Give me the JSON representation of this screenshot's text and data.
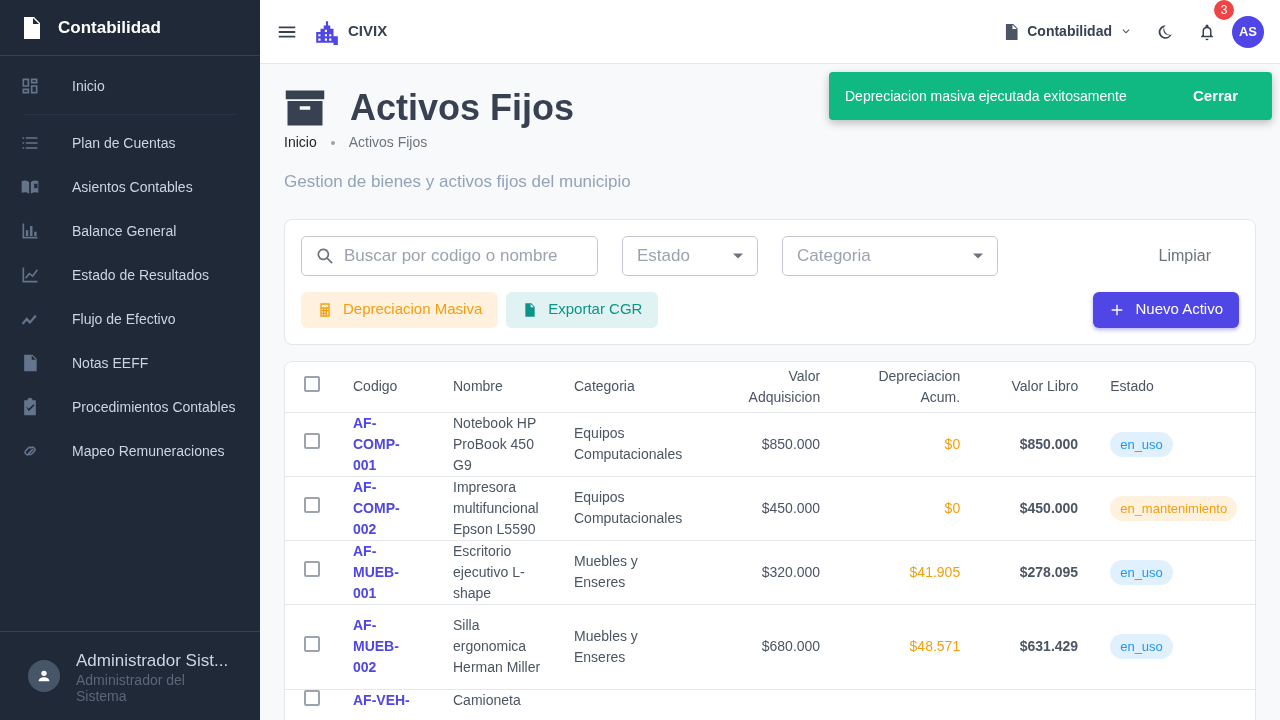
{
  "sidebar": {
    "title": "Contabilidad",
    "items": [
      {
        "label": "Inicio",
        "selected": false
      },
      {
        "label": "Plan de Cuentas",
        "selected": false
      },
      {
        "label": "Asientos Contables",
        "selected": false
      },
      {
        "label": "Balance General",
        "selected": false
      },
      {
        "label": "Estado de Resultados",
        "selected": false
      },
      {
        "label": "Flujo de Efectivo",
        "selected": false
      },
      {
        "label": "Notas EEFF",
        "selected": false
      },
      {
        "label": "Procedimientos Contables",
        "selected": false
      },
      {
        "label": "Mapeo Remuneraciones",
        "selected": false
      }
    ],
    "user": {
      "name": "Administrador Sist...",
      "role": "Administrador del Sistema"
    }
  },
  "topbar": {
    "brand": "CIVIX",
    "module": "Contabilidad",
    "notifications": "3",
    "avatar": "AS"
  },
  "toast": {
    "message": "Depreciacion masiva ejecutada exitosamente",
    "action": "Cerrar"
  },
  "page": {
    "title": "Activos Fijos",
    "breadcrumb": [
      "Inicio",
      "Activos Fijos"
    ],
    "subtitle": "Gestion de bienes y activos fijos del municipio"
  },
  "filters": {
    "search": {
      "placeholder": "Buscar por codigo o nombre"
    },
    "estado": {
      "placeholder": "Estado"
    },
    "categoria": {
      "placeholder": "Categoria"
    },
    "clear": "Limpiar"
  },
  "actions": [
    {
      "label": "Depreciacion Masiva",
      "kind": "warning"
    },
    {
      "label": "Exportar CGR",
      "kind": "teal"
    },
    {
      "label": "Nuevo Activo",
      "kind": "primary"
    }
  ],
  "table": {
    "select_all_checked": false,
    "columns": [
      "Codigo",
      "Nombre",
      "Categoria",
      "Valor Adquisicion",
      "Depreciacion Acum.",
      "Valor Libro",
      "Estado"
    ],
    "rows": [
      {
        "checked": false,
        "code": "AF-COMP-001",
        "name": "Notebook HP ProBook 450 G9",
        "category": "Equipos Computacionales",
        "value": "$850.000",
        "depreciation": "$0",
        "book": "$850.000",
        "status": "en_uso",
        "color": "#2196f3"
      },
      {
        "checked": false,
        "code": "AF-COMP-002",
        "name": "Impresora multifuncional Epson L5590",
        "category": "Equipos Computacionales",
        "value": "$450.000",
        "depreciation": "$0",
        "book": "$450.000",
        "status": "en_mantenimiento",
        "color": "#f59e0b"
      },
      {
        "checked": false,
        "code": "AF-MUEB-001",
        "name": "Escritorio ejecutivo L-shape",
        "category": "Muebles y Enseres",
        "value": "$320.000",
        "depreciation": "$41.905",
        "book": "$278.095",
        "status": "en_uso",
        "color": "#2196f3"
      },
      {
        "checked": false,
        "code": "AF-MUEB-002",
        "name": "Silla ergonomica Herman Miller",
        "category": "Muebles y Enseres",
        "value": "$680.000",
        "depreciation": "$48.571",
        "book": "$631.429",
        "status": "en_uso",
        "color": "#2196f3"
      },
      {
        "checked": false,
        "code": "AF-VEH-",
        "name": "Camioneta"
      }
    ]
  }
}
